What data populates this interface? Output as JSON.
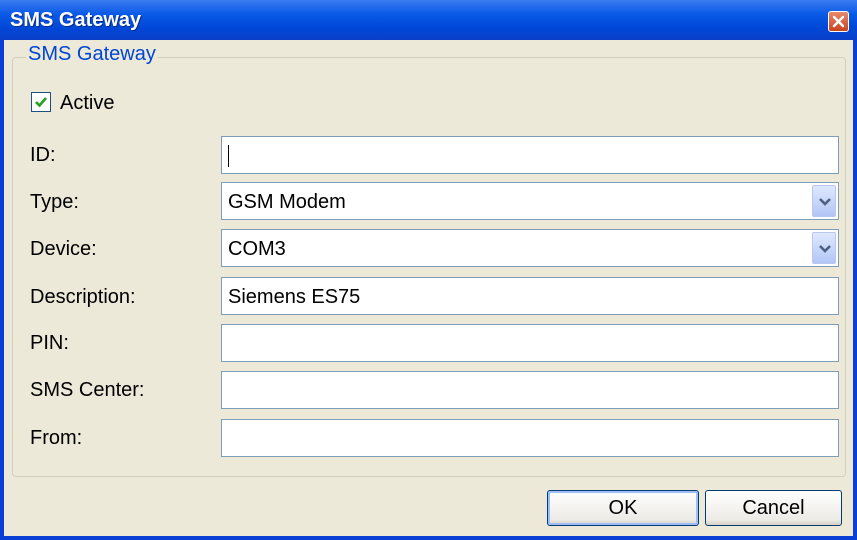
{
  "window": {
    "title": "SMS Gateway"
  },
  "group": {
    "title": "SMS Gateway",
    "active": {
      "label": "Active",
      "checked": true
    },
    "fields": [
      {
        "label": "ID:",
        "value": "",
        "type": "text"
      },
      {
        "label": "Type:",
        "value": "GSM Modem",
        "type": "combo"
      },
      {
        "label": "Device:",
        "value": "COM3",
        "type": "combo"
      },
      {
        "label": "Description:",
        "value": "Siemens ES75",
        "type": "text"
      },
      {
        "label": "PIN:",
        "value": "",
        "type": "text"
      },
      {
        "label": "SMS Center:",
        "value": "",
        "type": "text"
      },
      {
        "label": "From:",
        "value": "",
        "type": "text"
      }
    ]
  },
  "buttons": {
    "ok": "OK",
    "cancel": "Cancel"
  },
  "icons": {
    "close": "close-icon",
    "checkmark": "checkmark-icon",
    "dropdown": "chevron-down-icon"
  },
  "colors": {
    "title_bar": "#0047d8",
    "group_title": "#0046d5",
    "close_button": "#c8431f"
  }
}
